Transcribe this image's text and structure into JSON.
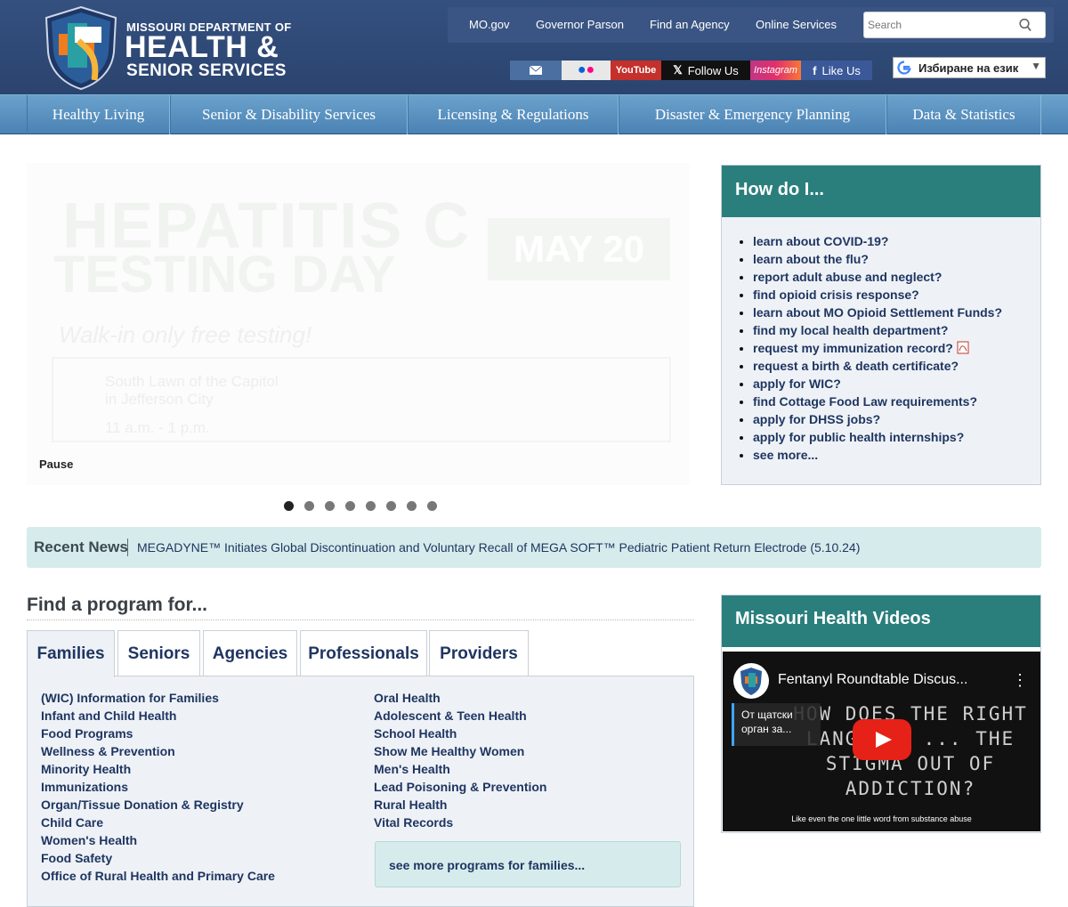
{
  "header": {
    "logo_line1": "MISSOURI DEPARTMENT OF",
    "logo_line2": "HEALTH &",
    "logo_line3": "SENIOR SERVICES",
    "toplinks": [
      "MO.gov",
      "Governor Parson",
      "Find an Agency",
      "Online Services"
    ],
    "search_placeholder": "Search",
    "social": {
      "youtube": "YouTube",
      "x": "Follow Us",
      "instagram": "Instagram",
      "facebook": "Like Us"
    },
    "translate_label": "Избиране на език"
  },
  "nav": [
    "Healthy Living",
    "Senior & Disability Services",
    "Licensing & Regulations",
    "Disaster & Emergency Planning",
    "Data & Statistics"
  ],
  "slider": {
    "line1": "HEPATITIS C",
    "line2": "TESTING DAY",
    "date": "MAY 20",
    "sub": "Walk-in only free testing!",
    "loc1": "South Lawn of the Capitol",
    "loc2": "in Jefferson City",
    "time": "11 a.m. - 1 p.m.",
    "pause_label": "Pause",
    "slide_count": 8,
    "active_slide": 1
  },
  "howdo": {
    "title": "How do I...",
    "items": [
      "learn about COVID-19?",
      "learn about the flu?",
      "report adult abuse and neglect?",
      "find opioid crisis response?",
      "learn about MO Opioid Settlement Funds?",
      "find my local health department?",
      "request my immunization record?",
      "request a birth & death certificate?",
      "apply for WIC?",
      "find Cottage Food Law requirements?",
      "apply for DHSS jobs?",
      "apply for public health internships?",
      "see more..."
    ]
  },
  "news": {
    "label": "Recent News",
    "headline": "MEGADYNE™ Initiates Global Discontinuation and Voluntary Recall of MEGA SOFT™ Pediatric Patient Return Electrode (5.10.24)"
  },
  "programs": {
    "title": "Find a program for...",
    "tabs": [
      "Families",
      "Seniors",
      "Agencies",
      "Professionals",
      "Providers"
    ],
    "col1": [
      "(WIC) Information for Families",
      "Infant and Child Health",
      "Food Programs",
      "Wellness & Prevention",
      "Minority Health",
      "Immunizations",
      "Organ/Tissue Donation & Registry",
      "Child Care",
      "Women's Health",
      "Food Safety",
      "Office of Rural Health and Primary Care"
    ],
    "col2": [
      "Oral Health",
      "Adolescent & Teen Health",
      "School Health",
      "Show Me Healthy Women",
      "Men's Health",
      "Lead Poisoning & Prevention",
      "Rural Health",
      "Vital Records"
    ],
    "see_more": "see more programs for families..."
  },
  "videos": {
    "title": "Missouri Health Videos",
    "video_title": "Fentanyl Roundtable Discus...",
    "card_text": "От щатски орган за...",
    "chalk_text": "HOW DOES THE RIGHT LANGUAGE ... THE STIGMA OUT OF ADDICTION?",
    "caption": "Like even the one little word from substance abuse"
  },
  "colors": {
    "header_bg": "#2f4a78",
    "nav_bg": "#5b93c2",
    "teal": "#2a7f7c",
    "light_teal": "#d6ecec",
    "link": "#1f3561"
  }
}
